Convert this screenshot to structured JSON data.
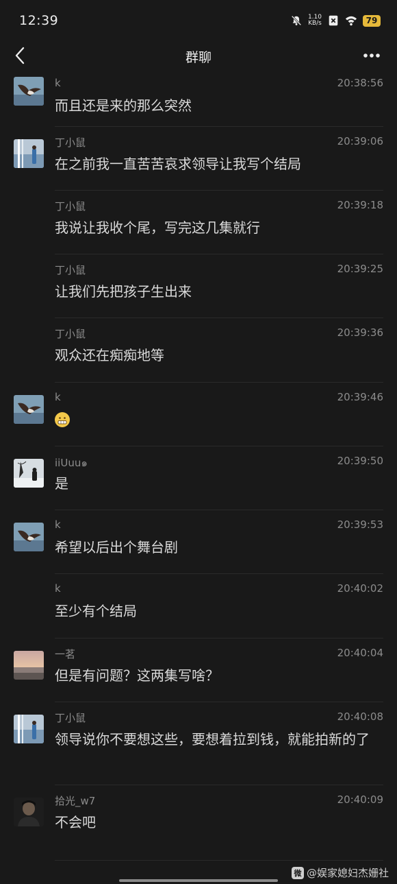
{
  "status_bar": {
    "time": "12:39",
    "net_speed_value": "1.10",
    "net_speed_unit": "KB/s",
    "battery": "79",
    "icons": [
      "bell-muted-icon",
      "data-icon",
      "wifi-icon",
      "battery-icon"
    ]
  },
  "nav": {
    "title": "群聊",
    "back_icon": "chevron-left-icon",
    "more_icon": "more-icon"
  },
  "messages": [
    {
      "sender": "k",
      "time": "20:38:56",
      "text": "而且还是来的那么突然",
      "avatar": "bird"
    },
    {
      "sender": "丁小鼠",
      "time": "20:39:06",
      "text": "在之前我一直苦苦哀求领导让我写个结局",
      "avatar": "girl-lake"
    },
    {
      "sender": "丁小鼠",
      "time": "20:39:18",
      "text": "我说让我收个尾，写完这几集就行",
      "avatar": ""
    },
    {
      "sender": "丁小鼠",
      "time": "20:39:25",
      "text": "让我们先把孩子生出来",
      "avatar": ""
    },
    {
      "sender": "丁小鼠",
      "time": "20:39:36",
      "text": "观众还在痴痴地等",
      "avatar": ""
    },
    {
      "sender": "k",
      "time": "20:39:46",
      "text": "",
      "emoji": "grimace-emoji",
      "avatar": "bird"
    },
    {
      "sender": "iiUuu๑",
      "time": "20:39:50",
      "text": "是",
      "avatar": "snow-tree"
    },
    {
      "sender": "k",
      "time": "20:39:53",
      "text": "希望以后出个舞台剧",
      "avatar": "bird"
    },
    {
      "sender": "k",
      "time": "20:40:02",
      "text": "至少有个结局",
      "avatar": ""
    },
    {
      "sender": "一茗",
      "time": "20:40:04",
      "text": "但是有问题？这两集写啥？",
      "avatar": "sunset-beach"
    },
    {
      "sender": "丁小鼠",
      "time": "20:40:08",
      "text": "领导说你不要想这些，要想着拉到钱，就能拍新的了",
      "avatar": "girl-lake"
    },
    {
      "sender": "拾光_w7",
      "time": "20:40:09",
      "text": "不会吧",
      "avatar": "man-portrait"
    }
  ],
  "watermark": {
    "text": "@娱家媳妇杰姗社",
    "logo": "微"
  },
  "colors": {
    "background": "#191919",
    "text": "#d9d9d9",
    "meta": "#8c8c8c",
    "battery": "#e6b93a"
  }
}
